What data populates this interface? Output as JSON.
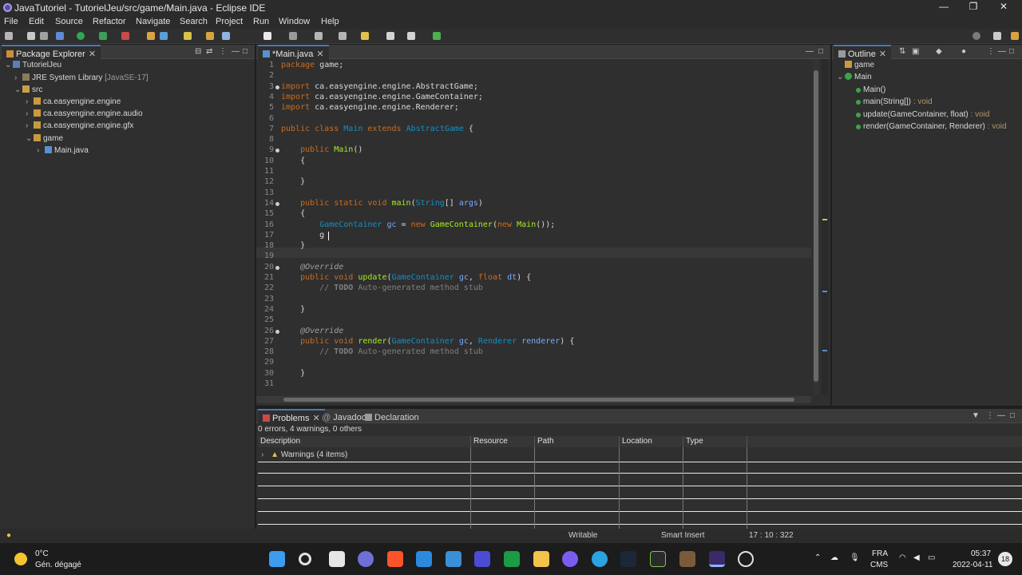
{
  "window": {
    "title": "JavaTutoriel - TutorielJeu/src/game/Main.java - Eclipse IDE",
    "minimize": "—",
    "maximize": "❐",
    "close": "✕"
  },
  "menu": [
    "File",
    "Edit",
    "Source",
    "Refactor",
    "Navigate",
    "Search",
    "Project",
    "Run",
    "Window",
    "Help"
  ],
  "package_explorer": {
    "tab_label": "Package Explorer",
    "tree": [
      {
        "label": "TutorielJeu",
        "suffix": "",
        "icon": "project-icon"
      },
      {
        "label": "JRE System Library",
        "suffix": "[JavaSE-17]",
        "icon": "library-icon"
      },
      {
        "label": "src",
        "suffix": "",
        "icon": "source-folder-icon"
      },
      {
        "label": "ca.easyengine.engine",
        "suffix": "",
        "icon": "package-icon"
      },
      {
        "label": "ca.easyengine.engine.audio",
        "suffix": "",
        "icon": "package-icon"
      },
      {
        "label": "ca.easyengine.engine.gfx",
        "suffix": "",
        "icon": "package-icon"
      },
      {
        "label": "game",
        "suffix": "",
        "icon": "package-icon"
      },
      {
        "label": "Main.java",
        "suffix": "",
        "icon": "java-file-icon"
      }
    ]
  },
  "editor": {
    "tab_label": "*Main.java",
    "lines": [
      {
        "n": "1",
        "html": "<span class='kw'>package</span> game;"
      },
      {
        "n": "2",
        "html": ""
      },
      {
        "n": "3",
        "html": "<span class='kw'>import</span> ca.easyengine.engine.AbstractGame;"
      },
      {
        "n": "4",
        "html": "<span class='kw'>import</span> ca.easyengine.engine.GameContainer;"
      },
      {
        "n": "5",
        "html": "<span class='kw'>import</span> ca.easyengine.engine.Renderer;"
      },
      {
        "n": "6",
        "html": ""
      },
      {
        "n": "7",
        "html": "<span class='kw'>public class</span> <span class='cls'>Main</span> <span class='kw'>extends</span> <span class='cls'>AbstractGame</span> {"
      },
      {
        "n": "8",
        "html": ""
      },
      {
        "n": "9",
        "html": "    <span class='kw'>public</span> <span class='fn'>Main</span>()"
      },
      {
        "n": "10",
        "html": "    {"
      },
      {
        "n": "11",
        "html": ""
      },
      {
        "n": "12",
        "html": "    }"
      },
      {
        "n": "13",
        "html": ""
      },
      {
        "n": "14",
        "html": "    <span class='kw'>public static void</span> <span class='fn'>main</span>(<span class='cls'>String</span>[] <span class='var'>args</span>)"
      },
      {
        "n": "15",
        "html": "    {"
      },
      {
        "n": "16",
        "html": "        <span class='cls'>GameContainer</span> <span class='var'>gc</span> = <span class='kw'>new</span> <span class='fn'>GameContainer</span>(<span class='kw'>new</span> <span class='fn'>Main</span>());"
      },
      {
        "n": "17",
        "html": "        g"
      },
      {
        "n": "18",
        "html": "    }"
      },
      {
        "n": "19",
        "html": ""
      },
      {
        "n": "20",
        "html": "    <span class='ann'>@Override</span>"
      },
      {
        "n": "21",
        "html": "    <span class='kw'>public void</span> <span class='fn'>update</span>(<span class='cls'>GameContainer</span> <span class='var'>gc</span>, <span class='kw'>float</span> <span class='var'>dt</span>) {"
      },
      {
        "n": "22",
        "html": "        <span class='cm'>// <span class='bold'>TODO</span> Auto-generated method stub</span>"
      },
      {
        "n": "23",
        "html": ""
      },
      {
        "n": "24",
        "html": "    }"
      },
      {
        "n": "25",
        "html": ""
      },
      {
        "n": "26",
        "html": "    <span class='ann'>@Override</span>"
      },
      {
        "n": "27",
        "html": "    <span class='kw'>public void</span> <span class='fn'>render</span>(<span class='cls'>GameContainer</span> <span class='var'>gc</span>, <span class='cls'>Renderer</span> <span class='var'>renderer</span>) {"
      },
      {
        "n": "28",
        "html": "        <span class='cm'>// <span class='bold'>TODO</span> Auto-generated method stub</span>"
      },
      {
        "n": "29",
        "html": ""
      },
      {
        "n": "30",
        "html": "    }"
      },
      {
        "n": "31",
        "html": ""
      }
    ]
  },
  "outline": {
    "tab_label": "Outline",
    "items": [
      {
        "label": "game",
        "type": ""
      },
      {
        "label": "Main",
        "type": ""
      },
      {
        "label": "Main()",
        "type": ""
      },
      {
        "label": "main(String[])",
        "type": " : void"
      },
      {
        "label": "update(GameContainer, float)",
        "type": " : void"
      },
      {
        "label": "render(GameContainer, Renderer)",
        "type": " : void"
      }
    ]
  },
  "problems": {
    "tabs": [
      "Problems",
      "Javadoc",
      "Declaration"
    ],
    "summary": "0 errors, 4 warnings, 0 others",
    "columns": [
      "Description",
      "Resource",
      "Path",
      "Location",
      "Type"
    ],
    "rows": [
      {
        "description": "Warnings (4 items)"
      }
    ]
  },
  "status": {
    "writable": "Writable",
    "insert_mode": "Smart Insert",
    "position": "17 : 10 : 322"
  },
  "taskbar": {
    "weather_temp": "0°C",
    "weather_desc": "Gén. dégagé",
    "lang": "FRA",
    "layout": "CMS",
    "time": "05:37",
    "date": "2022-04-11",
    "notif_count": "18"
  },
  "colors": {
    "keyword": "#cc6c1d",
    "class": "#1290c3",
    "method": "#a7ec21",
    "variable": "#79abff",
    "comment": "#808080"
  }
}
